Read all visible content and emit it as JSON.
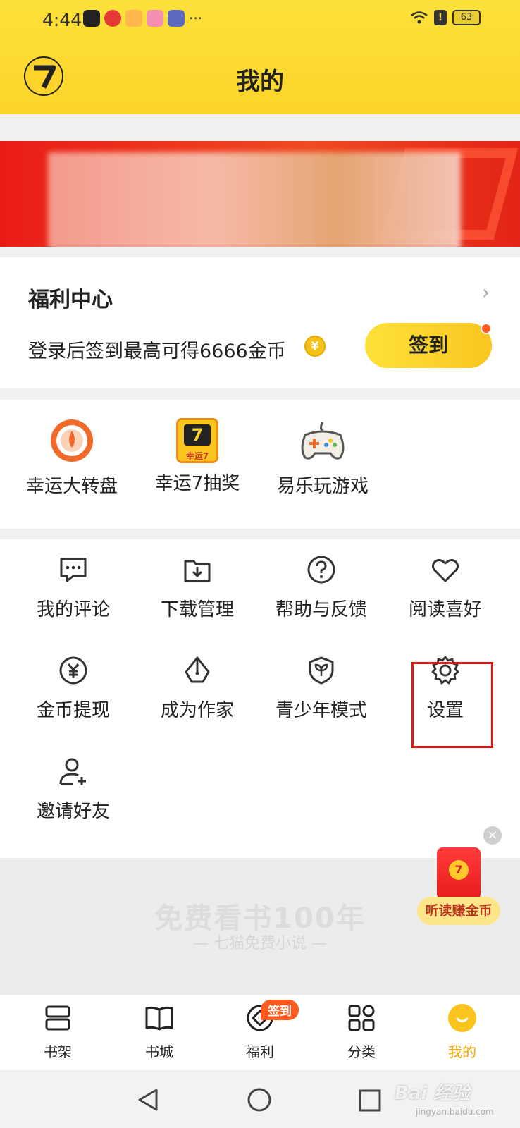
{
  "status_bar": {
    "time": "4:44",
    "battery": "63",
    "more": "···"
  },
  "header": {
    "title": "我的"
  },
  "welfare": {
    "title": "福利中心",
    "desc": "登录后签到最高可得6666金币",
    "checkin_label": "签到",
    "arrow": "›",
    "coin_glyph": "¥"
  },
  "features": [
    {
      "label": "幸运大转盘",
      "icon": "lucky-wheel-icon"
    },
    {
      "label": "幸运7抽奖",
      "icon": "lucky7-icon",
      "badge": "幸运7"
    },
    {
      "label": "易乐玩游戏",
      "icon": "gamepad-icon"
    }
  ],
  "menu": [
    {
      "label": "我的评论",
      "icon": "comment-icon"
    },
    {
      "label": "下载管理",
      "icon": "download-icon"
    },
    {
      "label": "帮助与反馈",
      "icon": "help-icon"
    },
    {
      "label": "阅读喜好",
      "icon": "heart-icon"
    },
    {
      "label": "金币提现",
      "icon": "coin-withdraw-icon"
    },
    {
      "label": "成为作家",
      "icon": "pen-nib-icon"
    },
    {
      "label": "青少年模式",
      "icon": "teen-shield-icon"
    },
    {
      "label": "设置",
      "icon": "gear-icon"
    },
    {
      "label": "邀请好友",
      "icon": "add-user-icon"
    }
  ],
  "promo": {
    "headline": "免费看书100年",
    "sub": "— 七猫免费小说 —"
  },
  "floating": {
    "close": "×",
    "listen_label": "听读赚金币"
  },
  "bottom_nav": [
    {
      "label": "书架",
      "icon": "bookshelf-icon"
    },
    {
      "label": "书城",
      "icon": "open-book-icon"
    },
    {
      "label": "福利",
      "icon": "welfare-icon"
    },
    {
      "label": "分类",
      "icon": "grid-icon"
    },
    {
      "label": "我的",
      "icon": "profile-icon",
      "active": true
    }
  ],
  "nav_badge": "签到",
  "watermark": {
    "text": "Bai 经验",
    "sub": "jingyan.baidu.com"
  },
  "colors": {
    "brand_yellow": "#fdd22a",
    "highlight_red": "#e01818",
    "active_nav": "#f0a500"
  }
}
